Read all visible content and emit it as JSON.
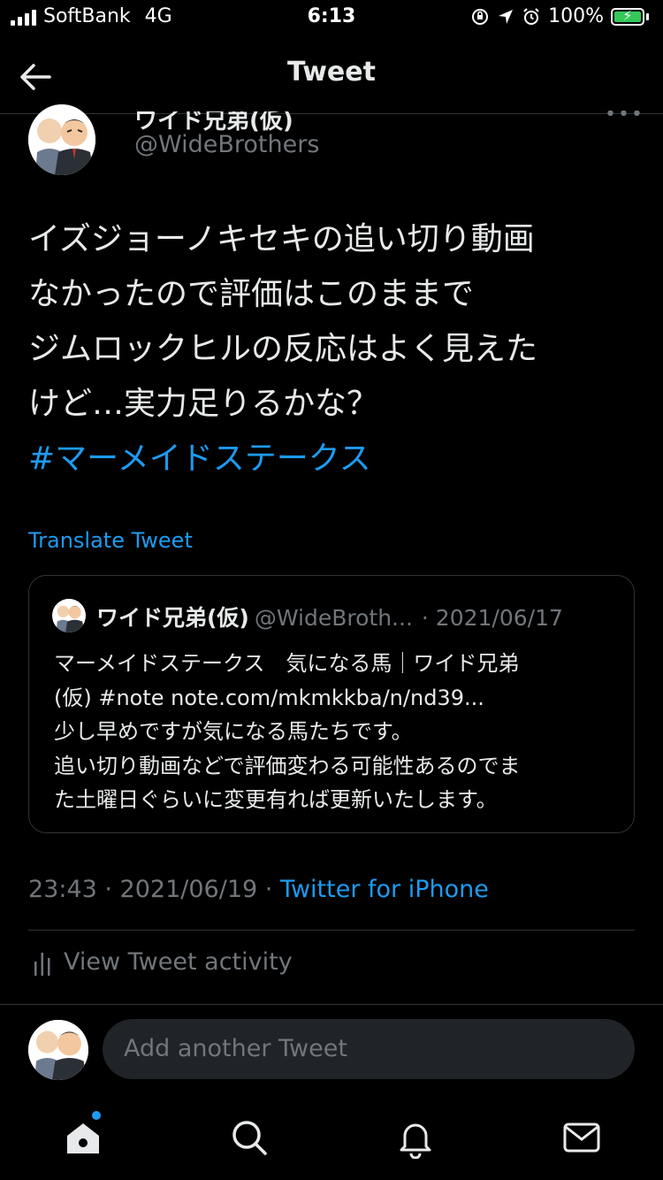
{
  "status_bar": {
    "carrier": "SoftBank",
    "network": "4G",
    "time": "6:13",
    "battery": "100%"
  },
  "header": {
    "title": "Tweet"
  },
  "tweet": {
    "author_name": "ワイド兄弟(仮)",
    "author_handle": "@WideBrothers",
    "text_lines": [
      "イズジョーノキセキの追い切り動画",
      "なかったので評価はこのままで",
      "ジムロックヒルの反応はよく見えた",
      "けど…実力足りるかな？"
    ],
    "hashtag": "#マーメイドステークス",
    "translate_label": "Translate Tweet",
    "time": "23:43 · 2021/06/19 · ",
    "source": "Twitter for iPhone"
  },
  "quote": {
    "name": "ワイド兄弟(仮)",
    "handle": "@WideBroth...",
    "date": "· 2021/06/17",
    "lines": [
      "マーメイドステークス　気になる馬｜ワイド兄弟",
      "(仮) #note note.com/mkmkkba/n/nd39...",
      "少し早めですが気になる馬たちです。",
      "追い切り動画などで評価変わる可能性あるのでま",
      "た土曜日ぐらいに変更有れば更新いたします。"
    ]
  },
  "activity": {
    "label": "View Tweet activity"
  },
  "reply": {
    "placeholder": "Add another Tweet"
  },
  "tab_bar": {
    "items": [
      "home-icon",
      "search-icon",
      "notifications-icon",
      "messages-icon"
    ]
  },
  "colors": {
    "background": "#000000",
    "accent": "#1d9bf0",
    "secondary_text": "#71767b",
    "border": "#2f3336"
  }
}
